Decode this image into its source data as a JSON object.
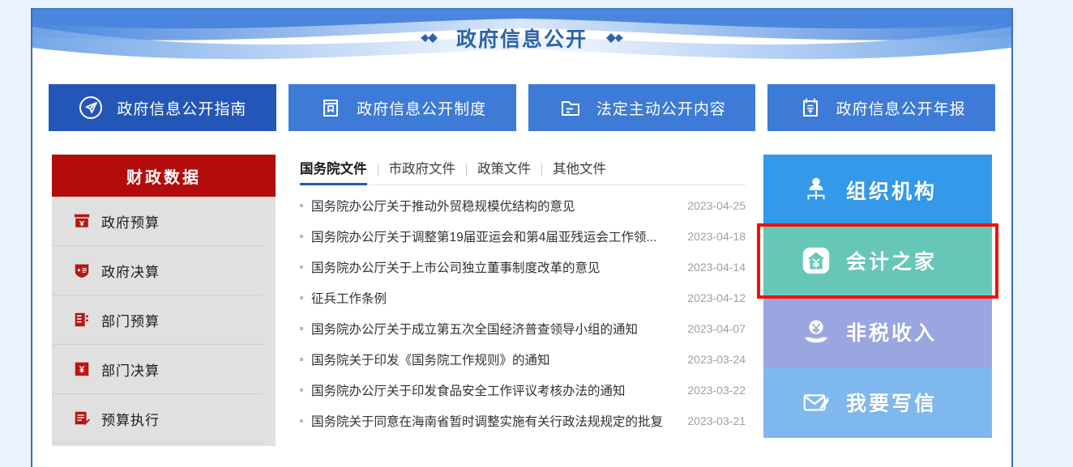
{
  "banner": {
    "title": "政府信息公开",
    "ornament_left": "diamond-pair-icon",
    "ornament_right": "diamond-pair-icon",
    "accent_color": "#2d62ac"
  },
  "nav": {
    "items": [
      {
        "label": "政府信息公开指南",
        "icon": "paper-plane-circle-icon",
        "active": true,
        "color": "#2456b8"
      },
      {
        "label": "政府信息公开制度",
        "icon": "book-icon",
        "active": false,
        "color": "#3d7bd6"
      },
      {
        "label": "法定主动公开内容",
        "icon": "folder-icon",
        "active": false,
        "color": "#3d7bd6"
      },
      {
        "label": "政府信息公开年报",
        "icon": "calendar-year-icon",
        "active": false,
        "color": "#3d7bd6"
      }
    ]
  },
  "sidebar": {
    "title": "财政数据",
    "header_color": "#b30c0c",
    "items": [
      {
        "label": "政府预算",
        "icon": "yuan-card-icon"
      },
      {
        "label": "政府决算",
        "icon": "shield-badge-icon"
      },
      {
        "label": "部门预算",
        "icon": "building-bars-icon"
      },
      {
        "label": "部门决算",
        "icon": "yuan-square-icon"
      },
      {
        "label": "预算执行",
        "icon": "document-pen-icon"
      }
    ]
  },
  "main": {
    "tabs": [
      {
        "label": "国务院文件",
        "active": true
      },
      {
        "label": "市政府文件",
        "active": false
      },
      {
        "label": "政策文件",
        "active": false
      },
      {
        "label": "其他文件",
        "active": false
      }
    ],
    "documents": [
      {
        "title": "国务院办公厅关于推动外贸稳规模优结构的意见",
        "date": "2023-04-25"
      },
      {
        "title": "国务院办公厅关于调整第19届亚运会和第4届亚残运会工作领...",
        "date": "2023-04-18"
      },
      {
        "title": "国务院办公厅关于上市公司独立董事制度改革的意见",
        "date": "2023-04-14"
      },
      {
        "title": "征兵工作条例",
        "date": "2023-04-12"
      },
      {
        "title": "国务院办公厅关于成立第五次全国经济普查领导小组的通知",
        "date": "2023-04-07"
      },
      {
        "title": "国务院关于印发《国务院工作规则》的通知",
        "date": "2023-03-24"
      },
      {
        "title": "国务院办公厅关于印发食品安全工作评议考核办法的通知",
        "date": "2023-03-22"
      },
      {
        "title": "国务院关于同意在海南省暂时调整实施有关行政法规规定的批复",
        "date": "2023-03-21"
      }
    ]
  },
  "quick_links": {
    "highlight_color": "#fb0d05",
    "items": [
      {
        "label": "组织机构",
        "icon": "org-chart-icon",
        "color": "#3399e8",
        "highlighted": false
      },
      {
        "label": "会计之家",
        "icon": "house-yuan-icon",
        "color": "#66c7b8",
        "highlighted": true
      },
      {
        "label": "非税收入",
        "icon": "hand-coin-icon",
        "color": "#9aa6e0",
        "highlighted": false
      },
      {
        "label": "我要写信",
        "icon": "envelope-pen-icon",
        "color": "#7fb8ee",
        "highlighted": false
      }
    ]
  }
}
